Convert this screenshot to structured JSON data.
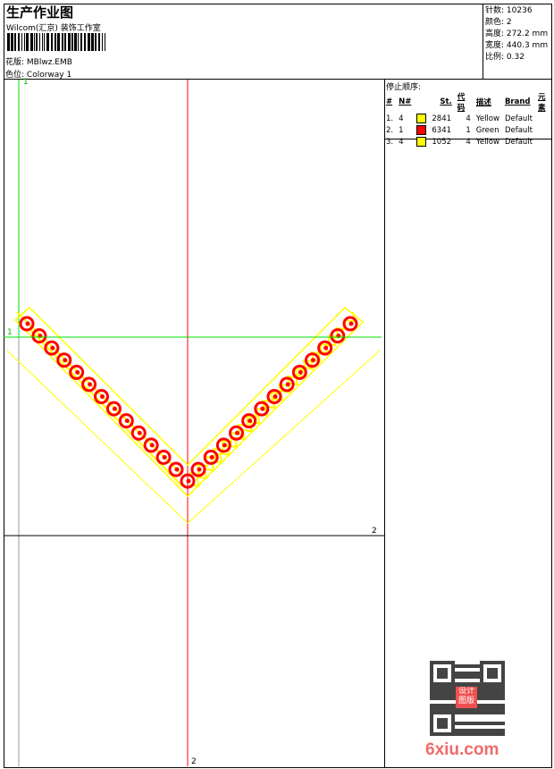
{
  "header": {
    "title": "生产作业图",
    "company": "Wilcom(汇京) 装饰工作室",
    "design_label": "花版:",
    "design_value": "MBlwz.EMB",
    "colorway_label": "色位:",
    "colorway_value": "Colorway 1"
  },
  "stats": [
    {
      "label": "针数:",
      "value": "10236"
    },
    {
      "label": "颜色:",
      "value": "2"
    },
    {
      "label": "高度:",
      "value": "272.2 mm"
    },
    {
      "label": "宽度:",
      "value": "440.3 mm"
    },
    {
      "label": "比例:",
      "value": "0.32"
    }
  ],
  "stop_sequence": {
    "title": "停止顺序:",
    "headers": [
      "#",
      "N#",
      "",
      "St.",
      "代码",
      "描述",
      "Brand",
      "元素"
    ],
    "rows": [
      {
        "idx": "1.",
        "n": "4",
        "color": "#ffff00",
        "st": "2841",
        "code": "4",
        "desc": "Yellow",
        "brand": "Default"
      },
      {
        "idx": "2.",
        "n": "1",
        "color": "#ff0000",
        "st": "6341",
        "code": "1",
        "desc": "Green",
        "brand": "Default"
      },
      {
        "idx": "3.",
        "n": "4",
        "color": "#ffff00",
        "st": "1052",
        "code": "4",
        "desc": "Yellow",
        "brand": "Default"
      }
    ]
  },
  "canvas": {
    "label_1a": "1",
    "label_1b": "1",
    "label_2a": "2",
    "label_2b": "2"
  },
  "watermark": {
    "text": "6xiu.com",
    "stamp": "设计图版"
  }
}
